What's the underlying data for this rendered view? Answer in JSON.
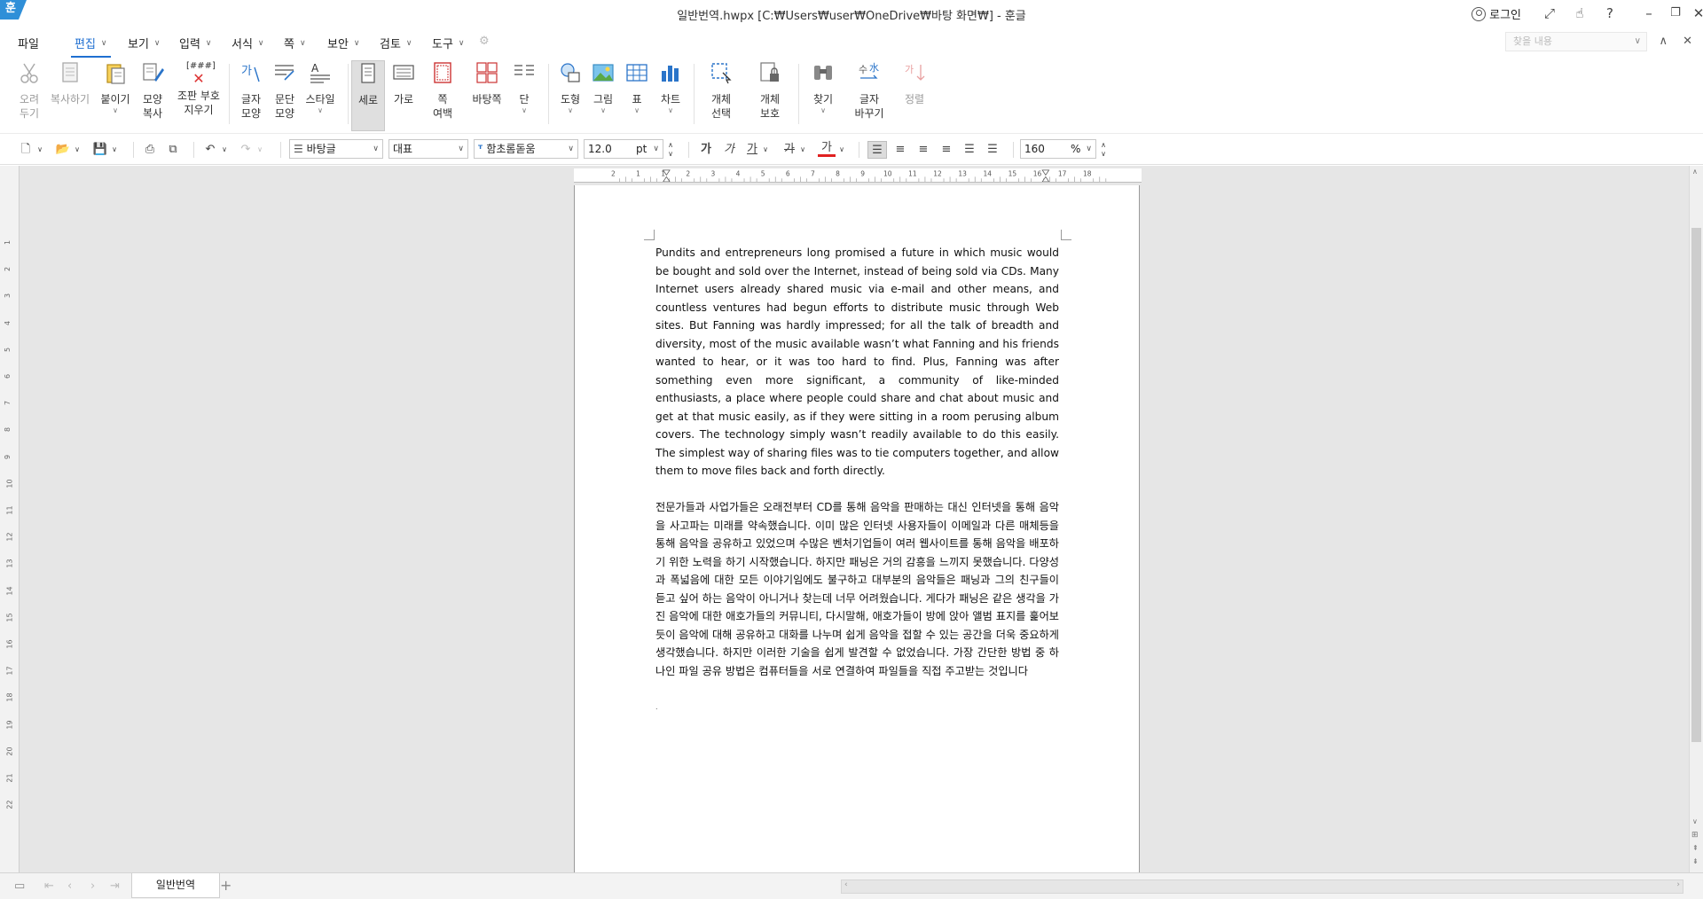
{
  "window": {
    "title": "일반번역.hwpx [C:₩Users₩user₩OneDrive₩바탕 화면₩] - 훈글",
    "app_logo": "훈",
    "login_label": "로그인"
  },
  "menu": {
    "items": [
      {
        "label": "파일",
        "has_chevron": false
      },
      {
        "label": "편집",
        "has_chevron": true,
        "active": true
      },
      {
        "label": "보기",
        "has_chevron": true
      },
      {
        "label": "입력",
        "has_chevron": true
      },
      {
        "label": "서식",
        "has_chevron": true
      },
      {
        "label": "쪽",
        "has_chevron": true
      },
      {
        "label": "보안",
        "has_chevron": true
      },
      {
        "label": "검토",
        "has_chevron": true
      },
      {
        "label": "도구",
        "has_chevron": true
      }
    ],
    "find_placeholder": "찾을 내용"
  },
  "ribbon": {
    "cut": [
      "오려",
      "두기"
    ],
    "copy": [
      "복사하기"
    ],
    "paste": [
      "붙이기"
    ],
    "format_copy": [
      "모양",
      "복사"
    ],
    "clear_codes": [
      "조판 부호",
      "지우기"
    ],
    "clear_codes_glyph": "[###]",
    "char_shape": [
      "글자",
      "모양"
    ],
    "para_shape": [
      "문단",
      "모양"
    ],
    "style": [
      "스타일"
    ],
    "portrait": [
      "세로"
    ],
    "landscape": [
      "가로"
    ],
    "page_margin": [
      "쪽",
      "여백"
    ],
    "page_bg": [
      "바탕쪽"
    ],
    "column": [
      "단"
    ],
    "shape": [
      "도형"
    ],
    "picture": [
      "그림"
    ],
    "table": [
      "표"
    ],
    "chart": [
      "차트"
    ],
    "object_select": [
      "개체",
      "선택"
    ],
    "object_protect": [
      "개체",
      "보호"
    ],
    "find": [
      "찾기"
    ],
    "replace_char": [
      "글자",
      "바꾸기"
    ],
    "sort": [
      "정렬"
    ]
  },
  "format_toolbar": {
    "style_value": "바탕글",
    "lang_value": "대표",
    "font_value": "함초롬돋움",
    "size_value": "12.0",
    "size_unit": "pt",
    "bold": "가",
    "italic": "가",
    "underline": "가",
    "strike": "가",
    "font_color": "가",
    "line_spacing_value": "160",
    "line_spacing_unit": "%"
  },
  "document": {
    "paragraph_en": "Pundits and entrepreneurs long promised a future in which music would be bought and sold over the Internet, instead of being sold via CDs. Many Internet users already shared music via e-mail and other means, and countless ventures had begun efforts to distribute music through Web sites. But Fanning was hardly impressed; for all the talk of breadth and diversity, most of the music available wasn’t what Fanning and his friends wanted to hear, or it was too hard to find. Plus, Fanning was after something even more significant, a community of like-minded enthusiasts, a place where people could share and chat about music and get at that music easily, as if they were sitting in a room perusing album covers. The technology simply wasn’t readily available to do this easily. The simplest way of sharing files was to tie computers together, and allow them to move files back and forth directly.",
    "paragraph_ko": "전문가들과 사업가들은 오래전부터 CD를 통해 음악을 판매하는 대신 인터넷을 통해 음악을 사고파는 미래를 약속했습니다. 이미 많은 인터넷 사용자들이 이메일과 다른 매체등을 통해 음악을 공유하고 있었으며 수많은 벤처기업들이 여러 웹사이트를 통해 음악을 배포하기 위한 노력을 하기 시작했습니다. 하지만 패닝은 거의 감흥을 느끼지 못했습니다. 다양성과 폭넓음에 대한 모든 이야기임에도 불구하고 대부분의 음악들은 패닝과 그의 친구들이 듣고 싶어 하는 음악이 아니거나 찾는데 너무 어려웠습니다. 게다가 패닝은 같은 생각을 가진 음악에 대한 애호가들의 커뮤니티, 다시말해, 애호가들이 방에 앉아 앨범 표지를 훑어보듯이 음악에 대해 공유하고 대화를 나누며 쉽게 음악을 접할 수 있는 공간을 더욱 중요하게 생각했습니다. 하지만 이러한 기술을 쉽게 발견할 수 없었습니다. 가장 간단한 방법 중 하나인 파일 공유 방법은 컴퓨터들을 서로 연결하여 파일들을 직접 주고받는 것입니다",
    "trailing_mark": "."
  },
  "ruler": {
    "h_ticks": [
      "2",
      "1",
      "1",
      "2",
      "3",
      "4",
      "5",
      "6",
      "7",
      "8",
      "9",
      "10",
      "11",
      "12",
      "13",
      "14",
      "15",
      "16",
      "17",
      "18"
    ],
    "v_ticks": [
      "1",
      "2",
      "3",
      "4",
      "5",
      "6",
      "7",
      "8",
      "9",
      "10",
      "11",
      "12",
      "13",
      "14",
      "15",
      "16",
      "17",
      "18",
      "19",
      "20",
      "21",
      "22"
    ]
  },
  "status": {
    "tab_label": "일반번역",
    "add_tab": "+"
  },
  "colors": {
    "accent": "#1f6fd1",
    "logo": "#2f8fd8",
    "font_color_underline": "#e02020"
  }
}
